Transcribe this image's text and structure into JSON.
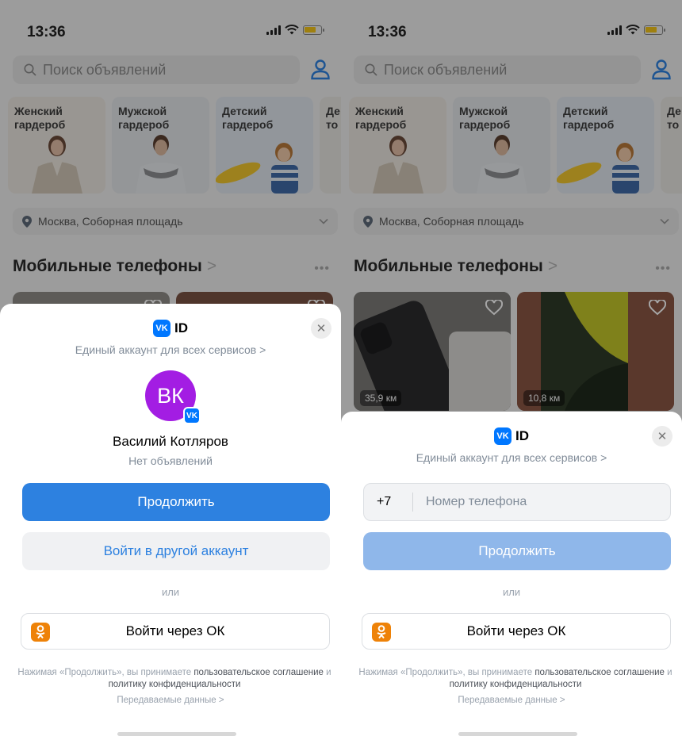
{
  "status_bar": {
    "time": "13:36"
  },
  "search": {
    "placeholder": "Поиск объявлений"
  },
  "categories": [
    {
      "label": "Женский\nгардероб"
    },
    {
      "label": "Мужской\nгардероб"
    },
    {
      "label": "Детский\nгардероб"
    },
    {
      "label": "Де\nто"
    }
  ],
  "location": {
    "text": "Москва, Соборная площадь"
  },
  "section": {
    "title": "Мобильные телефоны",
    "arrow": ">",
    "more": "•••"
  },
  "products": [
    {
      "distance": "35,9 км"
    },
    {
      "distance": "10,8 км"
    }
  ],
  "vk_sheet": {
    "logo_text": "VK",
    "brand": "ID",
    "account_link": "Единый аккаунт для всех сервисов",
    "link_arrow": ">",
    "close_glyph": "✕",
    "or_text": "или",
    "ok_button": "Войти через ОК",
    "terms_prefix": "Нажимая «Продолжить», вы принимаете ",
    "terms_agreement": "пользовательское соглашение",
    "terms_and": " и ",
    "terms_policy": "политику конфиденциальности",
    "data_link": "Передаваемые данные"
  },
  "left_sheet": {
    "avatar_initials": "ВК",
    "avatar_badge": "VK",
    "user_name": "Василий Котляров",
    "user_sub": "Нет объявлений",
    "continue_button": "Продолжить",
    "other_account_button": "Войти в другой аккаунт"
  },
  "right_sheet": {
    "country_code": "+7",
    "phone_placeholder": "Номер телефона",
    "continue_button": "Продолжить"
  },
  "colors": {
    "vk_blue": "#0077ff",
    "button_blue": "#2d81e0",
    "button_blue_disabled": "#8fb7ea",
    "ok_orange": "#ee8208",
    "avatar_purple": "#a31de3"
  }
}
